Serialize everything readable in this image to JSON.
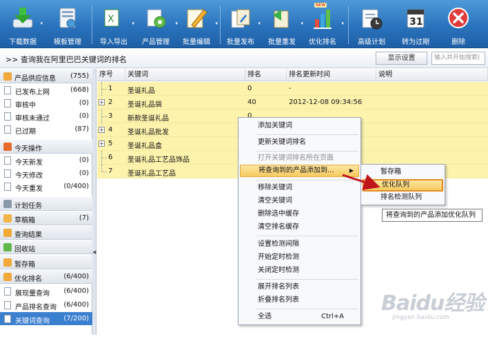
{
  "toolbar": {
    "buttons": [
      {
        "label": "下载数据",
        "icon": "download-icon"
      },
      {
        "label": "模板管理",
        "icon": "template-icon"
      },
      {
        "label": "导入导出",
        "icon": "excel-import-export-icon"
      },
      {
        "label": "产品管理",
        "icon": "product-manage-icon"
      },
      {
        "label": "批量编辑",
        "icon": "batch-edit-icon"
      },
      {
        "label": "批量发布",
        "icon": "batch-publish-icon"
      },
      {
        "label": "批量重发",
        "icon": "batch-republish-icon"
      },
      {
        "label": "优化排名",
        "icon": "ranking-chart-icon"
      },
      {
        "label": "高级计划",
        "icon": "schedule-clock-icon"
      },
      {
        "label": "转为过期",
        "icon": "calendar-icon"
      },
      {
        "label": "删除",
        "icon": "delete-icon"
      }
    ],
    "calendar_day": "31",
    "badge": "NEW"
  },
  "querybar": {
    "title": "查询我在阿里巴巴关键词的排名",
    "prefix": ">>",
    "show_settings": "显示设置",
    "search_placeholder": "输入并开始搜索(",
    "search_value": "输入并开始搜索("
  },
  "sidebar": {
    "groups": {
      "supply": {
        "label": "产品供应信息",
        "count": "(755)"
      },
      "published": {
        "label": "已发布上网",
        "count": "(668)"
      },
      "reviewing": {
        "label": "审核中",
        "count": "(0)"
      },
      "rejected": {
        "label": "审核未通过",
        "count": "(0)"
      },
      "expired": {
        "label": "已过期",
        "count": "(87)"
      },
      "today": {
        "label": "今天操作"
      },
      "today_new": {
        "label": "今天新发",
        "count": "(0)"
      },
      "today_edit": {
        "label": "今天修改",
        "count": "(0)"
      },
      "today_repub": {
        "label": "今天重发",
        "count": "(0/400)"
      },
      "plan": {
        "label": "计划任务"
      },
      "drafts": {
        "label": "草稿箱",
        "count": "(7)"
      },
      "query_results": {
        "label": "查询结果"
      },
      "recycle": {
        "label": "回收站"
      },
      "temp": {
        "label": "暂存箱"
      },
      "optimize": {
        "label": "优化排名",
        "count": "(6/400)"
      },
      "impressions": {
        "label": "展现量查询",
        "count": "(6/400)"
      },
      "product_rank": {
        "label": "产品排名查询",
        "count": "(6/400)"
      },
      "keyword_query": {
        "label": "关键词查询",
        "count": "(7/200)"
      }
    }
  },
  "grid": {
    "columns": [
      "序号",
      "关键词",
      "排名",
      "排名更新时间",
      "说明"
    ],
    "rows": [
      {
        "no": "1",
        "keyword": "圣诞礼品",
        "rank": "0",
        "time": "-",
        "expandable": false
      },
      {
        "no": "2",
        "keyword": "圣诞礼品袋",
        "rank": "40",
        "time": "2012-12-08 09:34:56",
        "expandable": true
      },
      {
        "no": "3",
        "keyword": "新款圣诞礼品",
        "rank": "0",
        "time": "",
        "expandable": false
      },
      {
        "no": "4",
        "keyword": "圣诞礼品批发",
        "rank": "",
        "time": "",
        "expandable": true
      },
      {
        "no": "5",
        "keyword": "圣诞礼品盒",
        "rank": "",
        "time": "",
        "expandable": true
      },
      {
        "no": "6",
        "keyword": "圣诞礼品工艺品饰品",
        "rank": "",
        "time": "",
        "expandable": false
      },
      {
        "no": "7",
        "keyword": "圣诞礼品工艺品",
        "rank": "",
        "time": "",
        "expandable": false
      }
    ]
  },
  "context_menu": {
    "items": [
      {
        "label": "添加关键词",
        "disabled": false
      },
      {
        "label": "更新关键词排名",
        "disabled": false
      },
      {
        "label": "打开关键词排名所在页面",
        "disabled": true
      },
      {
        "label": "将查询到的产品添加到...",
        "disabled": false,
        "highlighted": true,
        "submenu": true
      },
      {
        "label": "移除关键词",
        "disabled": false
      },
      {
        "label": "清空关键词",
        "disabled": false
      },
      {
        "label": "删除选中缓存",
        "disabled": false
      },
      {
        "label": "清空排名缓存",
        "disabled": false
      },
      {
        "label": "设置检测间隔",
        "disabled": false
      },
      {
        "label": "开始定时检测",
        "disabled": false
      },
      {
        "label": "关闭定时检测",
        "disabled": false
      },
      {
        "label": "展开排名列表",
        "disabled": false
      },
      {
        "label": "折叠排名列表",
        "disabled": false
      },
      {
        "label": "全选",
        "disabled": false,
        "shortcut": "Ctrl+A"
      }
    ]
  },
  "submenu": {
    "items": [
      {
        "label": "暂存箱"
      },
      {
        "label": "优化队列",
        "highlighted": true
      },
      {
        "label": "排名检测队列"
      }
    ]
  },
  "tooltip": {
    "text": "将查询到的产品添加优化队列"
  },
  "watermark": {
    "brand": "Baidu经验",
    "url": "jingyan.baidu.com"
  },
  "colors": {
    "toolbar": "#2a73bd",
    "selection": "#3b7fcf",
    "row_highlight": "#fdf3ad",
    "menu_highlight": "#f7ca60",
    "arrow": "#c0141b"
  }
}
